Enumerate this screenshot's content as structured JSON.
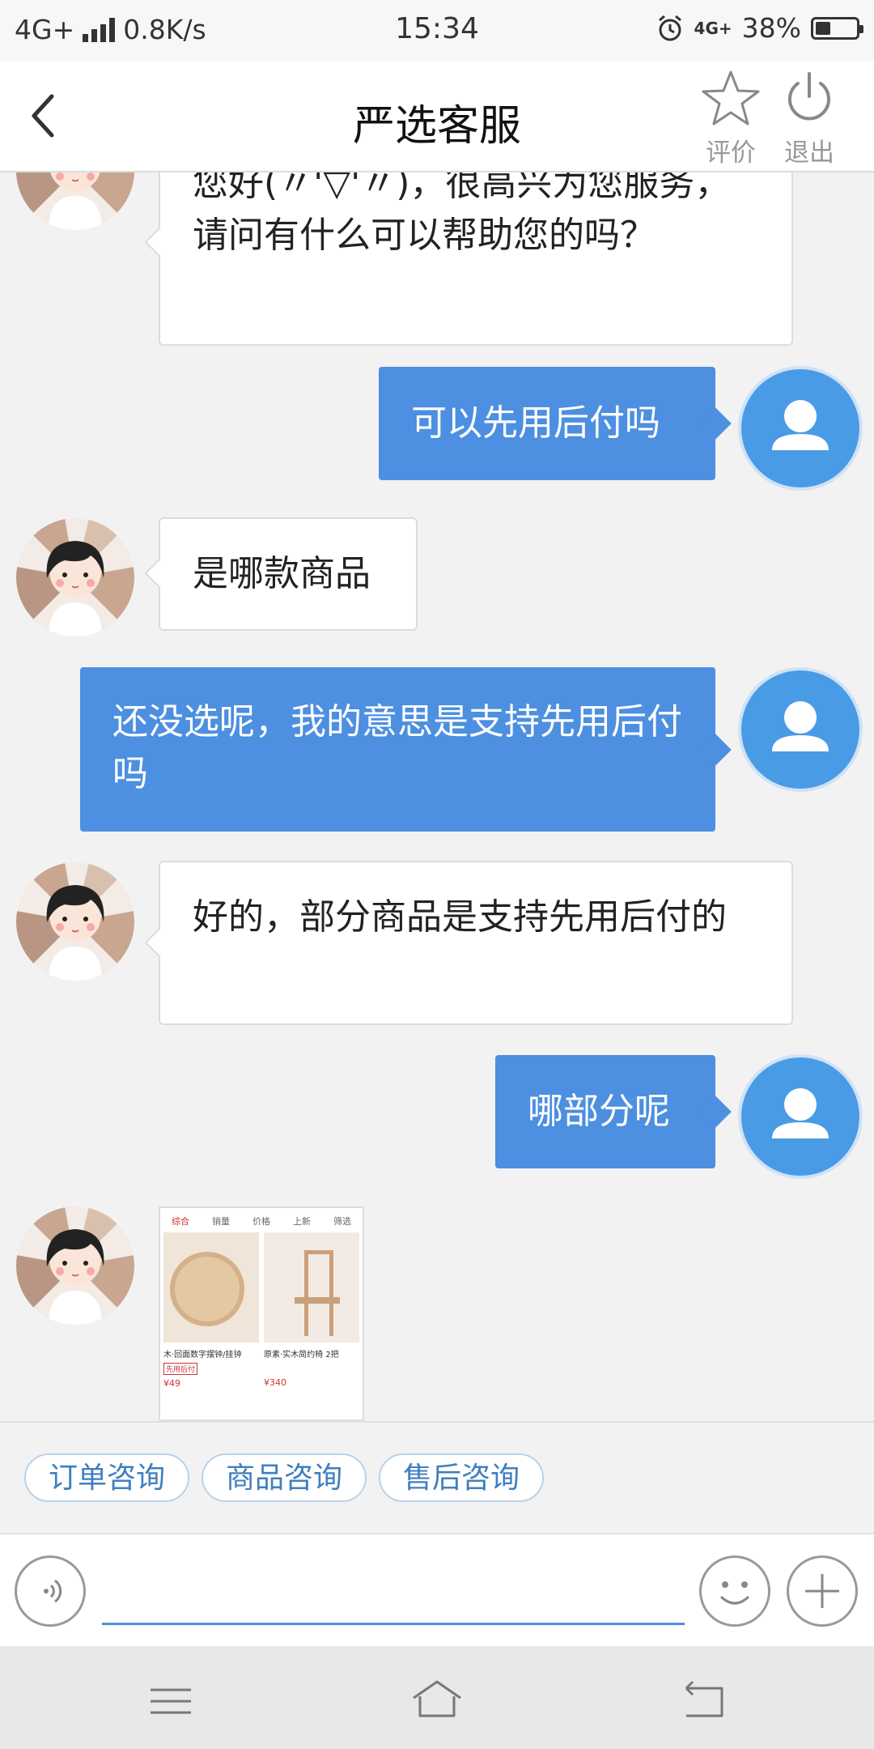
{
  "status_bar": {
    "network": "4G+",
    "speed": "0.8K/s",
    "time": "15:34",
    "network_right": "4G+",
    "battery": "38%",
    "battery_level": 0.38
  },
  "header": {
    "title": "严选客服",
    "rate_label": "评价",
    "exit_label": "退出"
  },
  "messages": [
    {
      "from": "agent",
      "text": "您好(〃'▽'〃)，很高兴为您服务，请问有什么可以帮助您的吗？"
    },
    {
      "from": "user",
      "text": "可以先用后付吗"
    },
    {
      "from": "agent",
      "text": "是哪款商品"
    },
    {
      "from": "user",
      "text": "还没选呢，我的意思是支持先用后付吗"
    },
    {
      "from": "agent",
      "text": "好的，部分商品是支持先用后付的"
    },
    {
      "from": "user",
      "text": "哪部分呢"
    }
  ],
  "image_message": {
    "tabs": [
      "综合",
      "销量",
      "价格",
      "上新",
      "筛选"
    ],
    "items": [
      {
        "caption": "木·回面数字摆钟/挂钟",
        "tag": "先用后付",
        "price": "¥49"
      },
      {
        "caption": "原素·实木简约椅 2把",
        "tag": "",
        "price": "¥340"
      }
    ]
  },
  "quick_replies": [
    "订单咨询",
    "商品咨询",
    "售后咨询"
  ],
  "input": {
    "value": "",
    "placeholder": ""
  },
  "colors": {
    "user_bubble": "#4d8fe0",
    "accent": "#4d8fe0",
    "chip_text": "#3f7fc0"
  }
}
